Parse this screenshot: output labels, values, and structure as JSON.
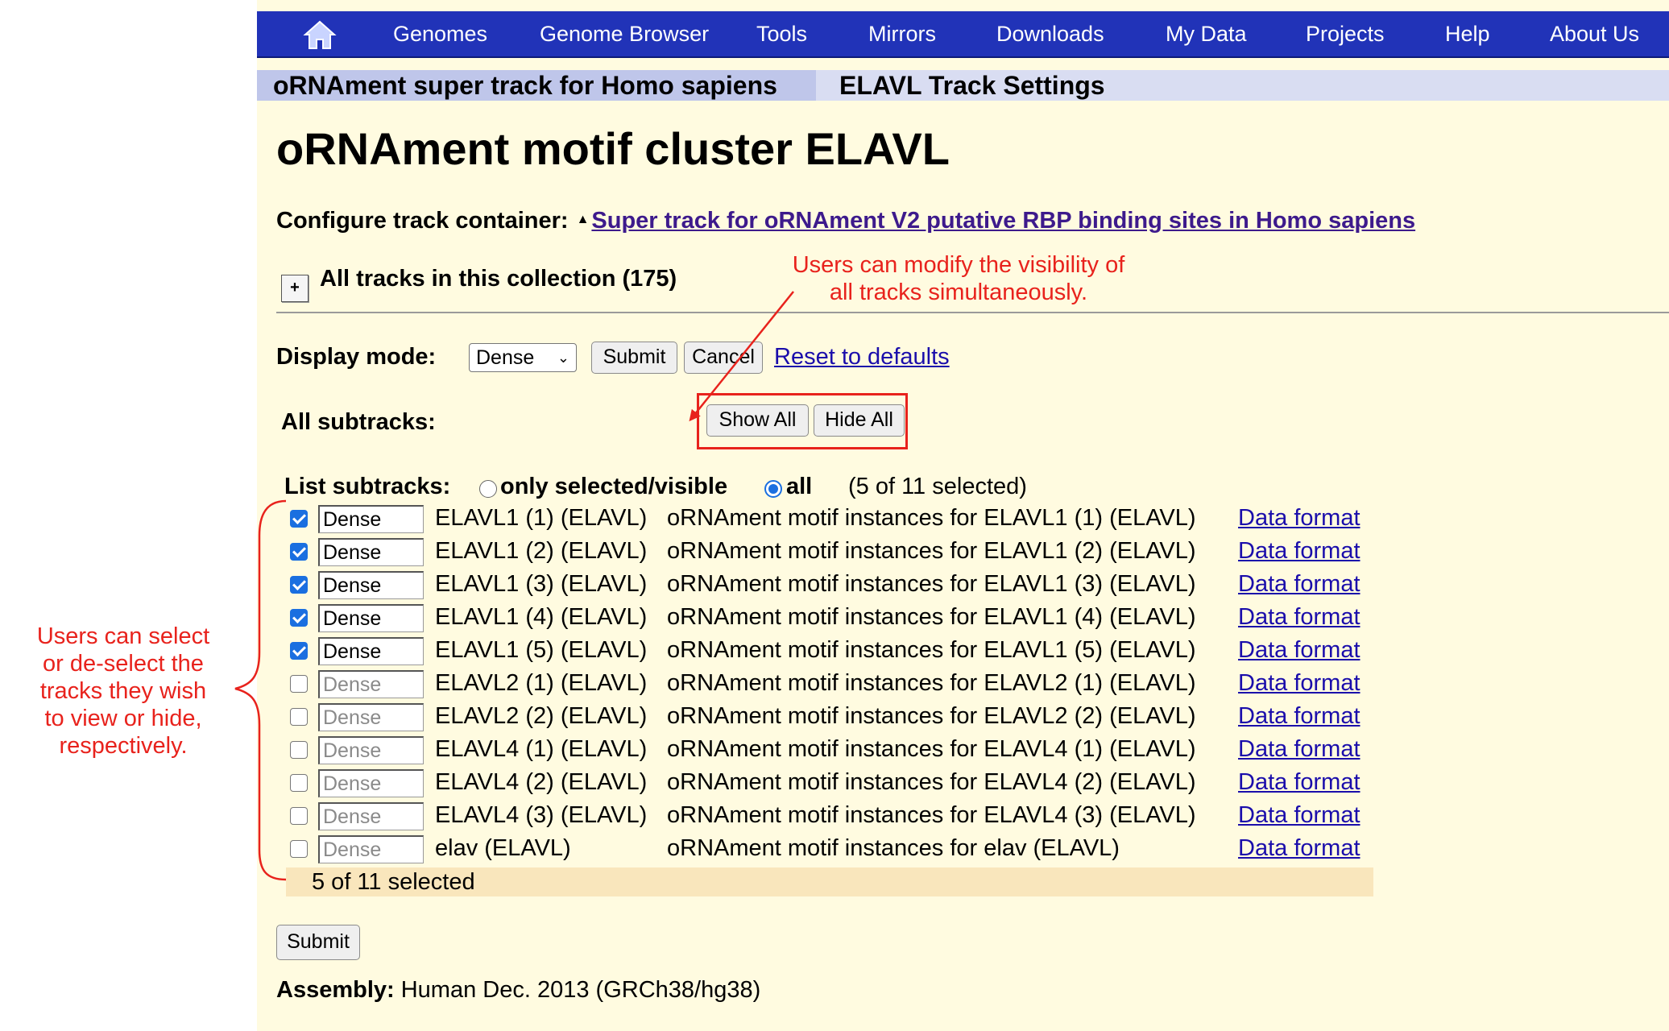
{
  "nav": {
    "items": [
      "Genomes",
      "Genome Browser",
      "Tools",
      "Mirrors",
      "Downloads",
      "My Data",
      "Projects",
      "Help",
      "About Us"
    ]
  },
  "breadcrumb": {
    "left": "oRNAment super track for Homo sapiens",
    "right": "ELAVL Track Settings"
  },
  "page_title": "oRNAment motif cluster ELAVL",
  "container": {
    "label": "Configure track container:",
    "caret": "▲",
    "link": "Super track for oRNAment V2 putative RBP binding sites in Homo sapiens"
  },
  "collection": {
    "expand": "+",
    "label": "All tracks in this collection (175)"
  },
  "display_mode": {
    "label": "Display mode:",
    "value": "Dense",
    "submit": "Submit",
    "cancel": "Cancel",
    "reset": "Reset to defaults"
  },
  "subtracks": {
    "label": "All subtracks:",
    "show_all": "Show All",
    "hide_all": "Hide All"
  },
  "list": {
    "label": "List subtracks:",
    "opt_selected": "only selected/visible",
    "opt_all": "all",
    "count": "(5 of 11 selected)",
    "selected_option": "all"
  },
  "tracks": [
    {
      "checked": true,
      "mode": "Dense",
      "name": "ELAVL1 (1) (ELAVL)",
      "desc": "oRNAment motif instances for ELAVL1 (1) (ELAVL)",
      "format": "Data format"
    },
    {
      "checked": true,
      "mode": "Dense",
      "name": "ELAVL1 (2) (ELAVL)",
      "desc": "oRNAment motif instances for ELAVL1 (2) (ELAVL)",
      "format": "Data format"
    },
    {
      "checked": true,
      "mode": "Dense",
      "name": "ELAVL1 (3) (ELAVL)",
      "desc": "oRNAment motif instances for ELAVL1 (3) (ELAVL)",
      "format": "Data format"
    },
    {
      "checked": true,
      "mode": "Dense",
      "name": "ELAVL1 (4) (ELAVL)",
      "desc": "oRNAment motif instances for ELAVL1 (4) (ELAVL)",
      "format": "Data format"
    },
    {
      "checked": true,
      "mode": "Dense",
      "name": "ELAVL1 (5) (ELAVL)",
      "desc": "oRNAment motif instances for ELAVL1 (5) (ELAVL)",
      "format": "Data format"
    },
    {
      "checked": false,
      "mode": "Dense",
      "name": "ELAVL2 (1) (ELAVL)",
      "desc": "oRNAment motif instances for ELAVL2 (1) (ELAVL)",
      "format": "Data format"
    },
    {
      "checked": false,
      "mode": "Dense",
      "name": "ELAVL2 (2) (ELAVL)",
      "desc": "oRNAment motif instances for ELAVL2 (2) (ELAVL)",
      "format": "Data format"
    },
    {
      "checked": false,
      "mode": "Dense",
      "name": "ELAVL4 (1) (ELAVL)",
      "desc": "oRNAment motif instances for ELAVL4 (1) (ELAVL)",
      "format": "Data format"
    },
    {
      "checked": false,
      "mode": "Dense",
      "name": "ELAVL4 (2) (ELAVL)",
      "desc": "oRNAment motif instances for ELAVL4 (2) (ELAVL)",
      "format": "Data format"
    },
    {
      "checked": false,
      "mode": "Dense",
      "name": "ELAVL4 (3) (ELAVL)",
      "desc": "oRNAment motif instances for ELAVL4 (3) (ELAVL)",
      "format": "Data format"
    },
    {
      "checked": false,
      "mode": "Dense",
      "name": "elav (ELAVL)",
      "desc": "oRNAment motif instances for elav (ELAVL)",
      "format": "Data format"
    }
  ],
  "footer_count": "5 of 11 selected",
  "bottom_submit": "Submit",
  "assembly": {
    "label": "Assembly:",
    "value": "Human Dec. 2013 (GRCh38/hg38)"
  },
  "annotations": {
    "top": [
      "Users can modify the visibility of",
      "all tracks simultaneously."
    ],
    "left": [
      "Users can select",
      "or de-select the",
      "tracks they wish",
      "to view or hide,",
      "respectively."
    ]
  },
  "colors": {
    "nav_bg": "#2133b8",
    "page_bg": "#fffbe0",
    "annotation": "#e8221c",
    "link": "#1a0dab",
    "footer_bg": "#f9e6bc"
  }
}
